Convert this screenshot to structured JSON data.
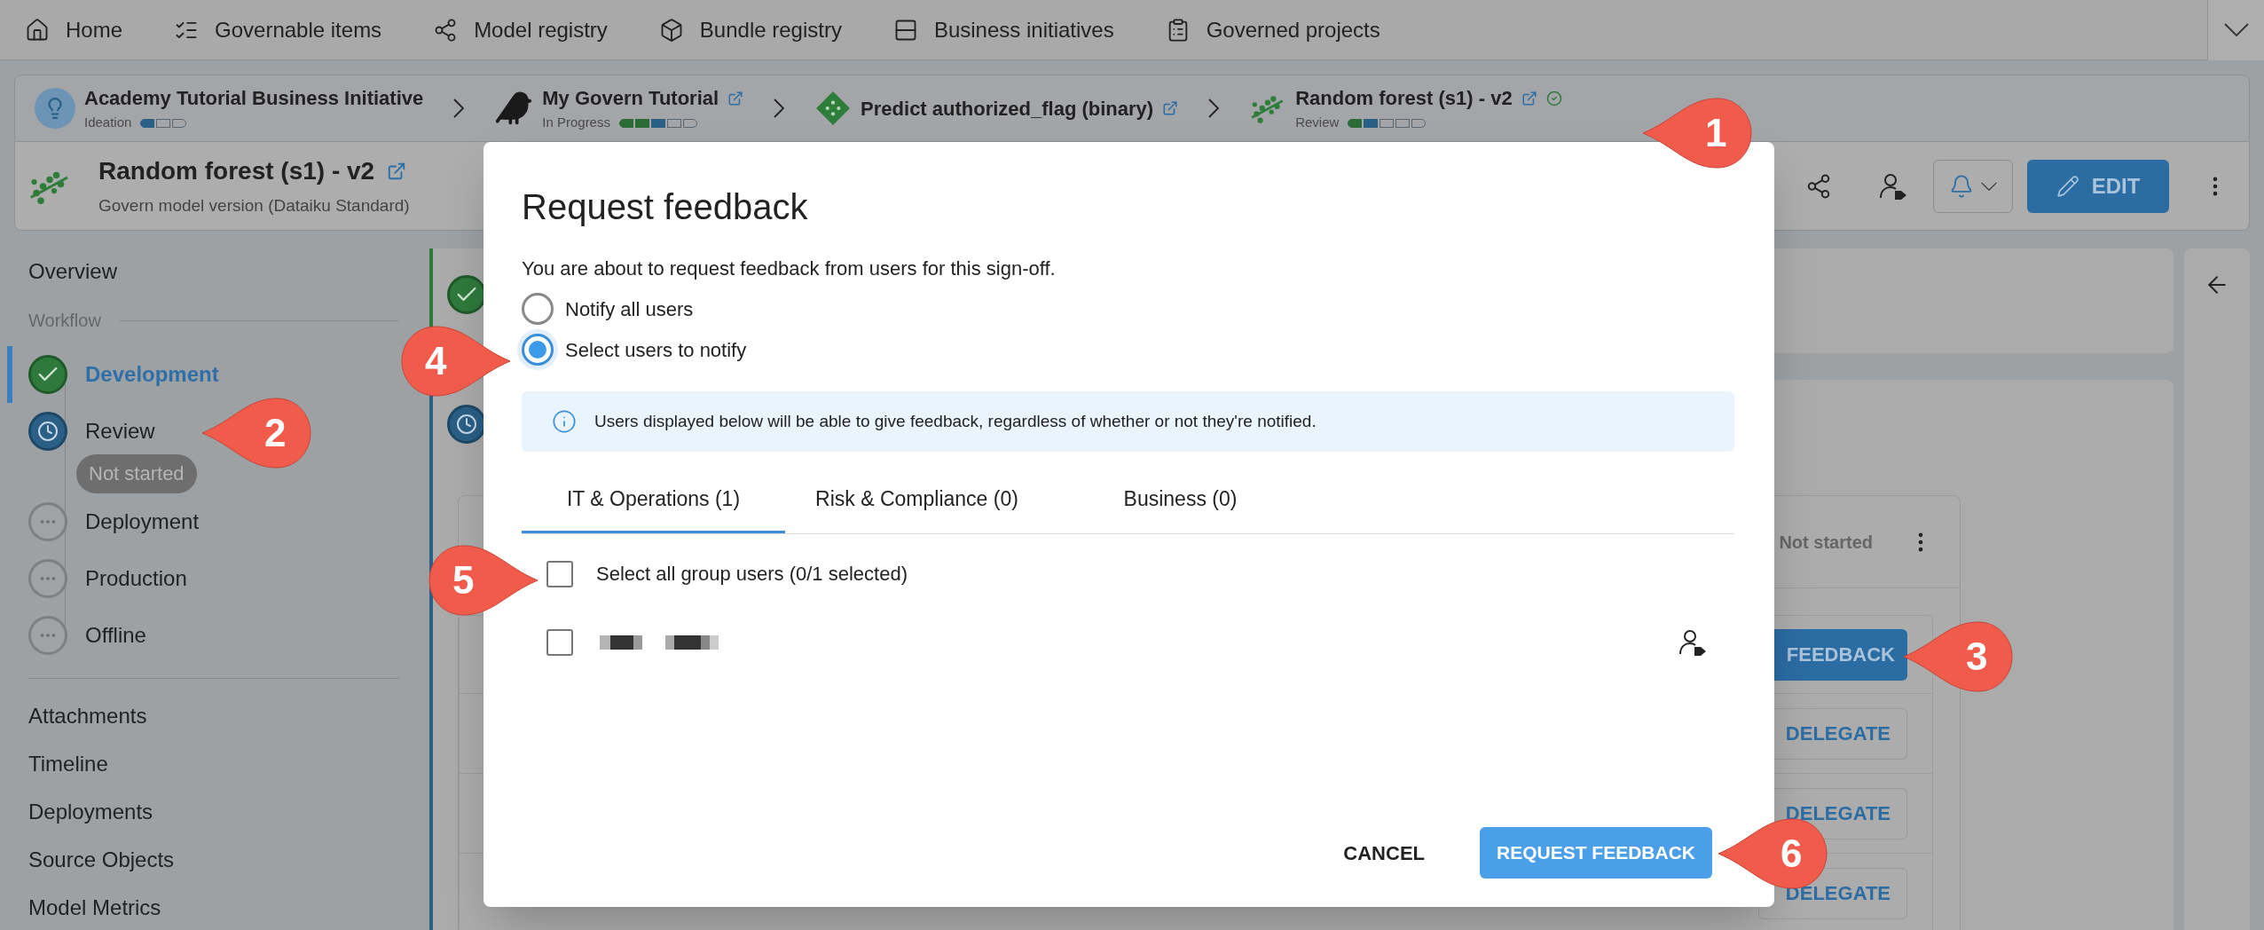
{
  "nav": {
    "items": [
      {
        "label": "Home"
      },
      {
        "label": "Governable items"
      },
      {
        "label": "Model registry"
      },
      {
        "label": "Bundle registry"
      },
      {
        "label": "Business initiatives"
      },
      {
        "label": "Governed projects"
      }
    ]
  },
  "breadcrumb": [
    {
      "kind": "initiative",
      "title": "Academy Tutorial Business Initiative",
      "status": "Ideation",
      "segments": [
        {
          "filled": true,
          "color": "#2a5f86"
        },
        {
          "filled": false
        },
        {
          "filled": false
        }
      ],
      "external_link": false,
      "validated": false
    },
    {
      "kind": "project",
      "title": "My Govern Tutorial",
      "status": "In Progress",
      "segments": [
        {
          "filled": true,
          "color": "#2b6b36"
        },
        {
          "filled": true,
          "color": "#2b6b36"
        },
        {
          "filled": true,
          "color": "#2a5f86"
        },
        {
          "filled": false
        },
        {
          "filled": false
        }
      ],
      "external_link": true,
      "validated": false
    },
    {
      "kind": "model",
      "title": "Predict authorized_flag (binary)",
      "external_link": true,
      "validated": false
    },
    {
      "kind": "version",
      "title": "Random forest (s1) - v2",
      "status": "Review",
      "segments": [
        {
          "filled": true,
          "color": "#2b6b36"
        },
        {
          "filled": true,
          "color": "#2a5f86"
        },
        {
          "filled": false
        },
        {
          "filled": false
        },
        {
          "filled": false
        }
      ],
      "external_link": true,
      "validated": true
    }
  ],
  "header": {
    "title": "Random forest (s1) - v2",
    "subtitle": "Govern model version (Dataiku Standard)",
    "edit_button": "EDIT"
  },
  "sidebar": {
    "overview": "Overview",
    "workflow_heading": "Workflow",
    "steps": [
      {
        "label": "Development",
        "kind": "done",
        "selected": true
      },
      {
        "label": "Review",
        "kind": "current",
        "selected": false,
        "badge": "Not started"
      },
      {
        "label": "Deployment",
        "kind": "todo",
        "selected": false
      },
      {
        "label": "Production",
        "kind": "todo",
        "selected": false
      },
      {
        "label": "Offline",
        "kind": "todo",
        "selected": false
      }
    ],
    "links": [
      "Attachments",
      "Timeline",
      "Deployments",
      "Source Objects",
      "Model Metrics"
    ]
  },
  "signoff": {
    "status": "Not started",
    "feedback_button": "FEEDBACK",
    "delegate_buttons": [
      "DELEGATE",
      "DELEGATE",
      "DELEGATE"
    ]
  },
  "dialog": {
    "title": "Request feedback",
    "intro": "You are about to request feedback from users for this sign-off.",
    "options": [
      {
        "label": "Notify all users",
        "selected": false
      },
      {
        "label": "Select users to notify",
        "selected": true
      }
    ],
    "info": "Users displayed below will be able to give feedback, regardless of whether or not they're notified.",
    "tabs": [
      {
        "label": "IT & Operations (1)",
        "selected": true
      },
      {
        "label": "Risk & Compliance (0)",
        "selected": false
      },
      {
        "label": "Business (0)",
        "selected": false
      }
    ],
    "select_all": {
      "label": "Select all group users (0/1 selected)",
      "checked": false
    },
    "users": [
      {
        "checked": false
      }
    ],
    "cancel": "CANCEL",
    "submit": "REQUEST FEEDBACK"
  },
  "callouts": [
    {
      "number": "1"
    },
    {
      "number": "2"
    },
    {
      "number": "3"
    },
    {
      "number": "4"
    },
    {
      "number": "5"
    },
    {
      "number": "6"
    }
  ]
}
